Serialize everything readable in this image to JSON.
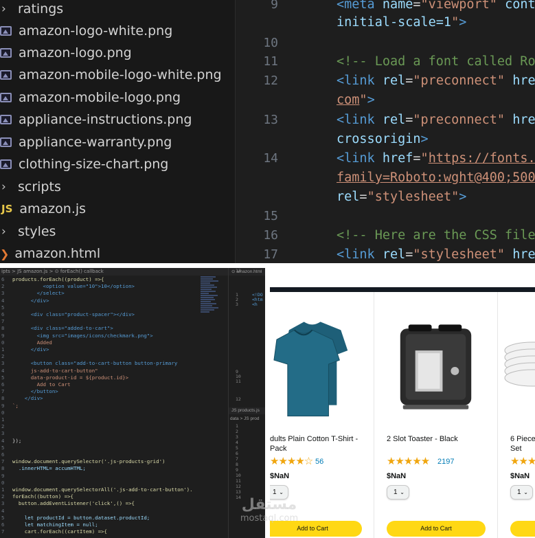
{
  "explorer": {
    "items": [
      {
        "type": "folder",
        "label": "ratings"
      },
      {
        "type": "image",
        "label": "amazon-logo-white.png"
      },
      {
        "type": "image",
        "label": "amazon-logo.png"
      },
      {
        "type": "image",
        "label": "amazon-mobile-logo-white.png"
      },
      {
        "type": "image",
        "label": "amazon-mobile-logo.png"
      },
      {
        "type": "image",
        "label": "appliance-instructions.png"
      },
      {
        "type": "image",
        "label": "appliance-warranty.png"
      },
      {
        "type": "image",
        "label": "clothing-size-chart.png"
      },
      {
        "type": "folder",
        "label": "scripts"
      },
      {
        "type": "js",
        "icon_text": "JS",
        "label": "amazon.js"
      },
      {
        "type": "folder",
        "label": "styles"
      },
      {
        "type": "html",
        "label": "amazon.html"
      }
    ]
  },
  "html_editor": {
    "line_numbers": [
      "9",
      "10",
      "11",
      "12",
      "13",
      "14",
      "15",
      "16",
      "17"
    ],
    "lines": {
      "l1a": "<meta name=\"viewport\" cont",
      "l1b": "initial-scale=1\">",
      "l3": "<!-- Load a font called Ro",
      "l4a": "<link rel=\"preconnect\" hre",
      "l4b": "com\">",
      "l5a": "<link rel=\"preconnect\" hre",
      "l5b": "crossorigin>",
      "l6a": "<link href=\"https://fonts.",
      "l6b": "family=Roboto:wght@400;500",
      "l6c": "rel=\"stylesheet\">",
      "l8": "<!-- Here are the CSS file",
      "l9": "<link rel=\"stylesheet\" hre"
    }
  },
  "js_editor": {
    "breadcrumb": "ipts > JS amazon.js > ⊙ forEach() callback",
    "side_tab": "⊙ amazon.html",
    "side_tab2": "JS products.js",
    "side_tab3": "data > JS prod",
    "line_numbers": [
      "6",
      "2",
      "3",
      "4",
      "5",
      "6",
      "7",
      "8",
      "9",
      "0",
      "1",
      "2",
      "3",
      "4",
      "5",
      "6",
      "7",
      "8",
      "9",
      "0",
      "1",
      "2",
      "3",
      "4",
      "5",
      "6",
      "7",
      "8",
      "9",
      "0",
      "1",
      "2",
      "3",
      "4",
      "5",
      "6",
      "7",
      "8",
      "9",
      "0",
      "1",
      "2",
      "3",
      "4",
      "5",
      "6",
      "7",
      "8",
      "9"
    ],
    "code_lines": [
      "products.forEach((product) =>{",
      "          <option value=\"10\">10</option>",
      "        </select>",
      "      </div>",
      "",
      "      <div class=\"product-spacer\"></div>",
      "",
      "      <div class=\"added-to-cart\">",
      "        <img src=\"images/icons/checkmark.png\">",
      "        Added",
      "      </div>",
      "",
      "      <button class=\"add-to-cart-button button-primary",
      "      js-add-to-cart-button\"",
      "      data-product-id = ${product.id}>",
      "        Add to Cart",
      "      </button>",
      "    </div>",
      "`;",
      "",
      "",
      "",
      "",
      "});",
      "",
      "",
      "window.document.querySelector('.js-products-grid')",
      "  .innerHTML= accumHTML;",
      "",
      "",
      "window.document.querySelectorAll('.js-add-to-cart-button').",
      "forEach((button) =>{",
      "  button.addEventListener('click',() =>{",
      "",
      "    let productId = button.dataset.productId;",
      "    let matchingItem = null;",
      "    cart.forEach((cartItem) =>{"
    ],
    "side_line_numbers": [
      "1",
      "2",
      "3",
      "",
      "",
      "",
      "",
      "",
      "",
      "9",
      "10",
      "11",
      "12",
      "",
      "13",
      "",
      "",
      "",
      "1",
      "2",
      "3",
      "4",
      "5",
      "6",
      "7",
      "8",
      "9",
      "10",
      "11",
      "12",
      "13",
      "14"
    ],
    "side_code": [
      "<!DO",
      "<htm",
      "  <h",
      "",
      "",
      "",
      "",
      ""
    ]
  },
  "shop": {
    "products": [
      {
        "name_line1": "dults Plain Cotton T-Shirt -",
        "name_line2": "Pack",
        "stars": "★★★★☆",
        "rating_count": "56",
        "price": "$NaN",
        "quantity": "1",
        "button": "Add to Cart"
      },
      {
        "name_line1": "2 Slot Toaster - Black",
        "name_line2": "",
        "stars": "★★★★★",
        "rating_count": "2197",
        "price": "$NaN",
        "quantity": "1",
        "button": "Add to Cart"
      },
      {
        "name_line1": "6 Piece",
        "name_line2": "Set",
        "stars": "★★★",
        "rating_count": "",
        "price": "$NaN",
        "quantity": "1",
        "button": ""
      }
    ]
  },
  "watermark": {
    "text_ar": "مستقل",
    "text_en": "mostaql.com"
  }
}
